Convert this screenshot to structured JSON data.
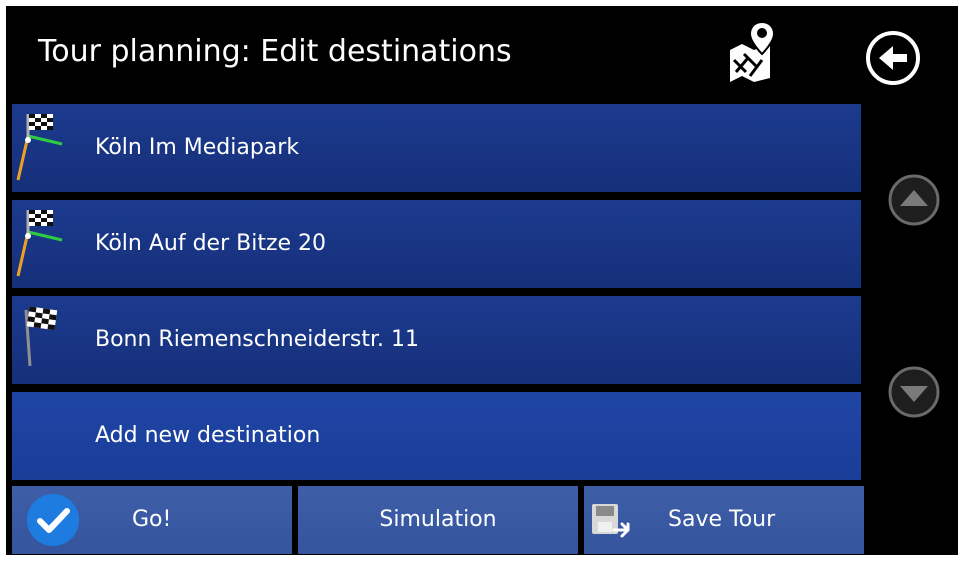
{
  "header": {
    "title": "Tour planning: Edit destinations",
    "map_icon": "map-pin-icon",
    "back_icon": "back-arrow-icon"
  },
  "destinations": [
    {
      "label": "Köln Im Mediapark",
      "icon": "checkered-flag-route-icon"
    },
    {
      "label": "Köln Auf der Bitze 20",
      "icon": "checkered-flag-route-icon"
    },
    {
      "label": "Bonn Riemenschneiderstr. 11",
      "icon": "checkered-flag-icon"
    }
  ],
  "add_destination": {
    "label": "Add new destination"
  },
  "scroll": {
    "up_icon": "scroll-up-icon",
    "down_icon": "scroll-down-icon"
  },
  "actions": {
    "go_label": "Go!",
    "simulation_label": "Simulation",
    "save_label": "Save Tour",
    "go_icon": "checkmark-icon",
    "save_icon": "save-tour-icon"
  },
  "colors": {
    "background": "#000000",
    "row_blue": "#1c3a8e",
    "button_blue": "#3e5fa8",
    "check_blue": "#1e7be0",
    "route_green": "#2ecc40",
    "route_orange": "#f0a020"
  }
}
